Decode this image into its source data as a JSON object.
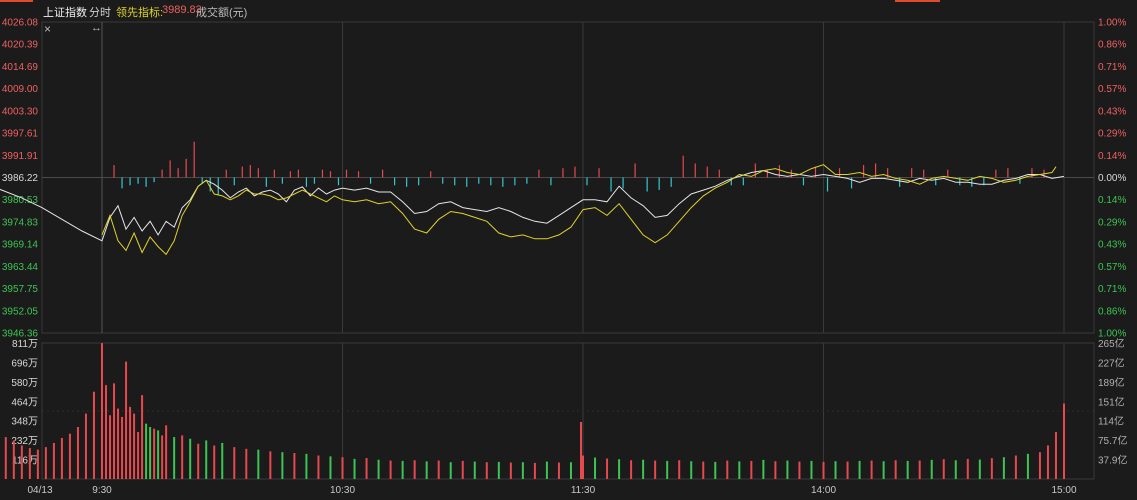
{
  "header": {
    "index_name": "上证指数",
    "mode": "分时",
    "leading_label": "领先指标:",
    "leading_value": "3989.83",
    "volume_label": "成交额(元)",
    "close_icon": "×",
    "resize_icon": "↔"
  },
  "colors": {
    "up": "#e8484e",
    "down": "#33c8d0",
    "down_volume": "#3cc552",
    "price_line": "#e6e6e6",
    "leading_line": "#e0d22a",
    "grid": "#3a3a3a",
    "background": "#1b1b1b",
    "text_up": "#f06060",
    "text_down": "#3cc552"
  },
  "chart_data": {
    "type": "line",
    "title": "上证指数 分时",
    "prev_close": 3986.22,
    "price_axis_ticks": [
      "4026.08",
      "4020.39",
      "4014.69",
      "4009.00",
      "4003.30",
      "3997.61",
      "3991.91",
      "3986.22",
      "3980.53",
      "3974.83",
      "3969.14",
      "3963.44",
      "3957.75",
      "3952.05",
      "3946.36"
    ],
    "pct_axis_ticks": [
      "1.00%",
      "0.86%",
      "0.71%",
      "0.57%",
      "0.43%",
      "0.29%",
      "0.14%",
      "0.00%",
      "0.14%",
      "0.29%",
      "0.43%",
      "0.57%",
      "0.71%",
      "0.86%",
      "1.00%"
    ],
    "volume_axis_left": [
      "811万",
      "696万",
      "580万",
      "464万",
      "348万",
      "232万",
      "116万"
    ],
    "volume_axis_right": [
      "265亿",
      "227亿",
      "189亿",
      "151亿",
      "114亿",
      "75.7亿",
      "37.9亿"
    ],
    "x_ticks": [
      "04/13",
      "9:30",
      "10:30",
      "11:30",
      "14:00",
      "15:00"
    ],
    "ylim": [
      3946.36,
      4026.08
    ],
    "series": [
      {
        "name": "上证指数",
        "color": "#e6e6e6",
        "x": [
          -30,
          -25,
          -20,
          -15,
          -10,
          -5,
          0,
          2,
          4,
          6,
          8,
          10,
          12,
          14,
          16,
          18,
          20,
          22,
          24,
          26,
          28,
          30,
          32,
          34,
          36,
          38,
          40,
          42,
          44,
          46,
          48,
          50,
          52,
          54,
          56,
          58,
          60,
          63,
          66,
          69,
          72,
          75,
          78,
          81,
          84,
          87,
          90,
          93,
          96,
          99,
          102,
          105,
          108,
          111,
          114,
          117,
          120,
          123,
          126,
          129,
          132,
          135,
          138,
          141,
          144,
          147,
          150,
          153,
          156,
          159,
          162,
          165,
          168,
          171,
          174,
          177,
          180,
          183,
          186,
          189,
          192,
          195,
          198,
          201,
          204,
          207,
          210,
          213,
          216,
          219,
          222,
          225,
          228,
          231,
          234,
          237,
          240
        ],
        "values": [
          3985.0,
          3983.0,
          3981.0,
          3978.5,
          3975.5,
          3972.5,
          3970.0,
          3976.0,
          3979.0,
          3973.0,
          3976.0,
          3972.5,
          3975.0,
          3971.5,
          3975.0,
          3973.5,
          3978.5,
          3980.5,
          3984.0,
          3985.5,
          3984.5,
          3983.0,
          3981.0,
          3982.5,
          3983.5,
          3981.5,
          3982.5,
          3983.0,
          3982.0,
          3980.0,
          3983.0,
          3983.8,
          3981.5,
          3983.5,
          3982.0,
          3983.0,
          3983.5,
          3983.0,
          3983.5,
          3982.5,
          3982.5,
          3980.0,
          3977.0,
          3977.5,
          3979.5,
          3980.0,
          3978.5,
          3978.0,
          3977.5,
          3978.5,
          3977.5,
          3976.0,
          3975.0,
          3974.5,
          3976.5,
          3978.5,
          3980.5,
          3980.5,
          3980.0,
          3984.0,
          3981.0,
          3979.0,
          3976.0,
          3976.5,
          3979.5,
          3982.0,
          3983.0,
          3984.0,
          3985.5,
          3986.5,
          3987.5,
          3988.0,
          3987.0,
          3986.5,
          3987.0,
          3986.5,
          3987.0,
          3986.5,
          3986.0,
          3985.0,
          3986.0,
          3986.0,
          3985.5,
          3985.0,
          3986.0,
          3985.5,
          3986.0,
          3985.0,
          3985.0,
          3984.5,
          3984.5,
          3985.5,
          3986.0,
          3987.0,
          3987.0,
          3986.0,
          3986.5
        ]
      },
      {
        "name": "领先指标",
        "color": "#e0d22a",
        "x": [
          0,
          2,
          4,
          6,
          8,
          10,
          12,
          14,
          16,
          18,
          20,
          22,
          24,
          26,
          28,
          30,
          32,
          34,
          36,
          38,
          40,
          42,
          44,
          46,
          48,
          50,
          52,
          54,
          56,
          58,
          60,
          63,
          66,
          69,
          72,
          75,
          78,
          81,
          84,
          87,
          90,
          93,
          96,
          99,
          102,
          105,
          108,
          111,
          114,
          117,
          120,
          123,
          126,
          129,
          132,
          135,
          138,
          141,
          144,
          147,
          150,
          153,
          156,
          159,
          162,
          165,
          168,
          171,
          174,
          177,
          180,
          183,
          186,
          189,
          192,
          195,
          198,
          201,
          204,
          207,
          210,
          213,
          216,
          219,
          222,
          225,
          228,
          231,
          234,
          237,
          238
        ],
        "values": [
          3971.5,
          3976.5,
          3970.0,
          3967.5,
          3972.0,
          3967.0,
          3971.0,
          3968.5,
          3966.5,
          3970.0,
          3976.5,
          3980.0,
          3984.0,
          3985.5,
          3982.0,
          3981.5,
          3980.5,
          3981.5,
          3983.0,
          3982.0,
          3982.0,
          3981.5,
          3980.5,
          3981.0,
          3982.0,
          3983.0,
          3982.0,
          3981.0,
          3980.0,
          3981.5,
          3980.5,
          3980.0,
          3980.5,
          3979.5,
          3980.0,
          3977.0,
          3973.0,
          3972.0,
          3975.5,
          3977.5,
          3977.0,
          3976.0,
          3975.0,
          3972.0,
          3971.0,
          3971.5,
          3970.5,
          3970.5,
          3971.5,
          3973.5,
          3978.0,
          3978.5,
          3976.5,
          3979.5,
          3975.5,
          3971.5,
          3969.5,
          3971.5,
          3975.0,
          3978.5,
          3981.5,
          3983.5,
          3985.0,
          3987.0,
          3986.5,
          3988.0,
          3988.5,
          3987.5,
          3987.0,
          3988.5,
          3989.5,
          3987.0,
          3987.0,
          3987.5,
          3986.5,
          3987.0,
          3986.0,
          3985.5,
          3984.5,
          3986.0,
          3986.5,
          3986.0,
          3985.5,
          3986.5,
          3986.0,
          3985.0,
          3985.5,
          3986.5,
          3987.0,
          3987.5,
          3989.0
        ]
      }
    ],
    "bars": [
      {
        "x": 3,
        "pct": 0.08
      },
      {
        "x": 5,
        "pct": -0.07
      },
      {
        "x": 7,
        "pct": -0.05
      },
      {
        "x": 9,
        "pct": -0.04
      },
      {
        "x": 11,
        "pct": -0.06
      },
      {
        "x": 13,
        "pct": -0.03
      },
      {
        "x": 15,
        "pct": 0.05
      },
      {
        "x": 17,
        "pct": 0.11
      },
      {
        "x": 19,
        "pct": 0.06
      },
      {
        "x": 21,
        "pct": 0.12
      },
      {
        "x": 23,
        "pct": 0.23
      },
      {
        "x": 25,
        "pct": -0.04
      },
      {
        "x": 27,
        "pct": -0.09
      },
      {
        "x": 29,
        "pct": -0.11
      },
      {
        "x": 31,
        "pct": 0.05
      },
      {
        "x": 33,
        "pct": -0.05
      },
      {
        "x": 35,
        "pct": 0.07
      },
      {
        "x": 37,
        "pct": 0.08
      },
      {
        "x": 39,
        "pct": 0.06
      },
      {
        "x": 41,
        "pct": -0.06
      },
      {
        "x": 43,
        "pct": 0.05
      },
      {
        "x": 45,
        "pct": -0.04
      },
      {
        "x": 47,
        "pct": 0.04
      },
      {
        "x": 49,
        "pct": 0.05
      },
      {
        "x": 51,
        "pct": -0.06
      },
      {
        "x": 53,
        "pct": -0.04
      },
      {
        "x": 55,
        "pct": 0.05
      },
      {
        "x": 57,
        "pct": 0.04
      },
      {
        "x": 59,
        "pct": -0.05
      },
      {
        "x": 61,
        "pct": 0.05
      },
      {
        "x": 64,
        "pct": 0.04
      },
      {
        "x": 67,
        "pct": -0.04
      },
      {
        "x": 70,
        "pct": 0.05
      },
      {
        "x": 73,
        "pct": -0.05
      },
      {
        "x": 76,
        "pct": -0.06
      },
      {
        "x": 79,
        "pct": -0.05
      },
      {
        "x": 82,
        "pct": 0.04
      },
      {
        "x": 85,
        "pct": -0.04
      },
      {
        "x": 88,
        "pct": -0.05
      },
      {
        "x": 91,
        "pct": -0.06
      },
      {
        "x": 94,
        "pct": -0.04
      },
      {
        "x": 97,
        "pct": -0.05
      },
      {
        "x": 100,
        "pct": -0.06
      },
      {
        "x": 103,
        "pct": -0.05
      },
      {
        "x": 106,
        "pct": -0.04
      },
      {
        "x": 109,
        "pct": 0.05
      },
      {
        "x": 112,
        "pct": -0.05
      },
      {
        "x": 115,
        "pct": 0.06
      },
      {
        "x": 118,
        "pct": 0.07
      },
      {
        "x": 121,
        "pct": -0.05
      },
      {
        "x": 124,
        "pct": 0.06
      },
      {
        "x": 127,
        "pct": -0.09
      },
      {
        "x": 130,
        "pct": -0.07
      },
      {
        "x": 133,
        "pct": 0.09
      },
      {
        "x": 136,
        "pct": -0.09
      },
      {
        "x": 139,
        "pct": -0.08
      },
      {
        "x": 142,
        "pct": -0.06
      },
      {
        "x": 145,
        "pct": 0.14
      },
      {
        "x": 148,
        "pct": 0.09
      },
      {
        "x": 151,
        "pct": 0.07
      },
      {
        "x": 154,
        "pct": 0.05
      },
      {
        "x": 157,
        "pct": -0.05
      },
      {
        "x": 160,
        "pct": -0.05
      },
      {
        "x": 163,
        "pct": 0.09
      },
      {
        "x": 166,
        "pct": 0.05
      },
      {
        "x": 169,
        "pct": 0.08
      },
      {
        "x": 172,
        "pct": 0.05
      },
      {
        "x": 175,
        "pct": -0.05
      },
      {
        "x": 178,
        "pct": 0.07
      },
      {
        "x": 181,
        "pct": -0.09
      },
      {
        "x": 184,
        "pct": 0.06
      },
      {
        "x": 187,
        "pct": -0.07
      },
      {
        "x": 190,
        "pct": 0.08
      },
      {
        "x": 193,
        "pct": 0.09
      },
      {
        "x": 196,
        "pct": 0.06
      },
      {
        "x": 199,
        "pct": -0.06
      },
      {
        "x": 202,
        "pct": 0.06
      },
      {
        "x": 205,
        "pct": 0.05
      },
      {
        "x": 208,
        "pct": -0.05
      },
      {
        "x": 211,
        "pct": 0.05
      },
      {
        "x": 214,
        "pct": -0.05
      },
      {
        "x": 217,
        "pct": -0.06
      },
      {
        "x": 220,
        "pct": -0.05
      },
      {
        "x": 223,
        "pct": 0.05
      },
      {
        "x": 226,
        "pct": 0.06
      },
      {
        "x": 229,
        "pct": -0.04
      },
      {
        "x": 232,
        "pct": 0.06
      },
      {
        "x": 235,
        "pct": 0.05
      }
    ],
    "volume": {
      "unit": "万",
      "prev_x": [
        -30,
        -28,
        -26,
        -24,
        -22,
        -20,
        -18,
        -16,
        -14,
        -12,
        -10,
        -8,
        -6,
        -4,
        -2
      ],
      "prev_values": [
        210,
        225,
        240,
        250,
        230,
        200,
        185,
        175,
        190,
        215,
        245,
        270,
        310,
        390,
        520
      ],
      "x": [
        0,
        1,
        2,
        3,
        4,
        5,
        6,
        7,
        8,
        9,
        10,
        11,
        12,
        13,
        14,
        15,
        16,
        18,
        20,
        22,
        24,
        26,
        28,
        30,
        33,
        36,
        39,
        42,
        45,
        48,
        51,
        54,
        57,
        60,
        63,
        66,
        69,
        72,
        75,
        78,
        81,
        84,
        87,
        90,
        93,
        96,
        99,
        102,
        105,
        108,
        111,
        114,
        117,
        119.5,
        120,
        123,
        126,
        129,
        132,
        135,
        138,
        141,
        144,
        147,
        150,
        153,
        156,
        159,
        162,
        165,
        168,
        171,
        174,
        177,
        180,
        183,
        186,
        189,
        192,
        195,
        198,
        201,
        204,
        207,
        210,
        213,
        216,
        219,
        222,
        225,
        228,
        231,
        234,
        236,
        238,
        240
      ],
      "values": [
        810,
        560,
        380,
        570,
        420,
        370,
        700,
        430,
        390,
        280,
        500,
        330,
        310,
        300,
        290,
        260,
        320,
        250,
        260,
        240,
        210,
        230,
        200,
        215,
        190,
        180,
        175,
        165,
        160,
        155,
        150,
        140,
        135,
        130,
        120,
        125,
        115,
        110,
        108,
        112,
        105,
        110,
        100,
        108,
        104,
        100,
        102,
        98,
        100,
        96,
        104,
        98,
        100,
        340,
        140,
        128,
        122,
        118,
        112,
        115,
        110,
        108,
        112,
        106,
        104,
        102,
        110,
        105,
        108,
        114,
        106,
        110,
        104,
        108,
        102,
        106,
        104,
        108,
        110,
        106,
        112,
        108,
        110,
        114,
        118,
        112,
        120,
        116,
        124,
        130,
        140,
        150,
        160,
        200,
        280,
        450,
        620
      ],
      "down_x": [
        11,
        12,
        14,
        18,
        22,
        26,
        30,
        39,
        45,
        51,
        57,
        63,
        69,
        75,
        81,
        87,
        93,
        99,
        105,
        111,
        117,
        123,
        129,
        135,
        141,
        147,
        153,
        159,
        165,
        171,
        177,
        183,
        189,
        195,
        201,
        207,
        213,
        219,
        225,
        231
      ]
    }
  }
}
